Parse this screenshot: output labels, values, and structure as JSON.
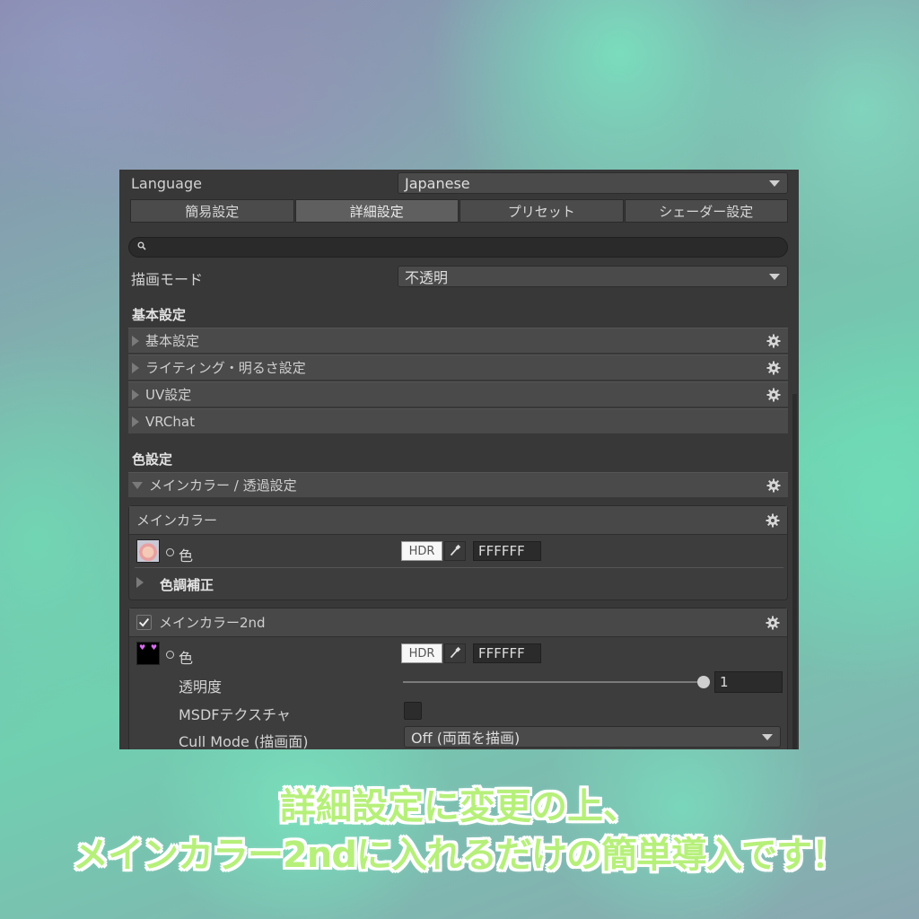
{
  "language": {
    "label": "Language",
    "value": "Japanese"
  },
  "tabs": [
    {
      "label": "簡易設定",
      "active": false
    },
    {
      "label": "詳細設定",
      "active": true
    },
    {
      "label": "プリセット",
      "active": false
    },
    {
      "label": "シェーダー設定",
      "active": false
    }
  ],
  "search": {
    "placeholder": ""
  },
  "render_mode": {
    "label": "描画モード",
    "value": "不透明"
  },
  "basic": {
    "heading": "基本設定",
    "items": [
      {
        "label": "基本設定",
        "gear": true
      },
      {
        "label": "ライティング・明るさ設定",
        "gear": true
      },
      {
        "label": "UV設定",
        "gear": true
      },
      {
        "label": "VRChat",
        "gear": false
      }
    ]
  },
  "color": {
    "heading": "色設定",
    "fold_label": "メインカラー / 透過設定",
    "main_color": {
      "title": "メインカラー",
      "color_label": "色",
      "hdr_label": "HDR",
      "hex": "FFFFFF",
      "sub_fold": "色調補正"
    },
    "main_color_2nd": {
      "title": "メインカラー2nd",
      "checked": true,
      "color_label": "色",
      "hdr_label": "HDR",
      "hex": "FFFFFF",
      "opacity_label": "透明度",
      "opacity_value": "1",
      "opacity_fraction": 1.0,
      "msdf_label": "MSDFテクスチャ",
      "msdf_checked": false,
      "cull_label": "Cull Mode (描画面)",
      "cull_value": "Off (両面を描画)"
    }
  },
  "caption": {
    "line1": "詳細設定に変更の上、",
    "line2": "メインカラー2ndに入れるだけの簡単導入です！"
  },
  "colors": {
    "panel": "#383838",
    "caption_fill": "#b6f07a",
    "caption_outline": "#ffffff"
  }
}
